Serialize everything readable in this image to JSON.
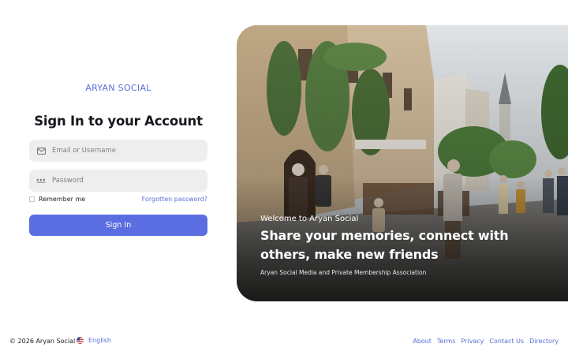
{
  "brand": {
    "name": "ARYAN SOCIAL"
  },
  "form": {
    "title": "Sign In to your Account",
    "email_placeholder": "Email or Username",
    "password_placeholder": "Password",
    "remember_label": "Remember me",
    "forgot_label": "Forgotten password?",
    "submit_label": "Sign In"
  },
  "hero": {
    "eyebrow": "Welcome to Aryan Social",
    "headline": "Share your memories, connect with others, make new friends",
    "caption": "Aryan Social Media and Private Membership Association"
  },
  "footer": {
    "copyright": "© 2026 Aryan Social",
    "language": "English",
    "links": [
      "About",
      "Terms",
      "Privacy",
      "Contact Us",
      "Directory"
    ]
  },
  "colors": {
    "accent": "#5b6ee1",
    "link": "#5a6fd8",
    "field_bg": "#eeeeef"
  },
  "icons": {
    "email": "envelope-icon",
    "password": "password-dots-icon",
    "language": "us-flag-icon"
  }
}
